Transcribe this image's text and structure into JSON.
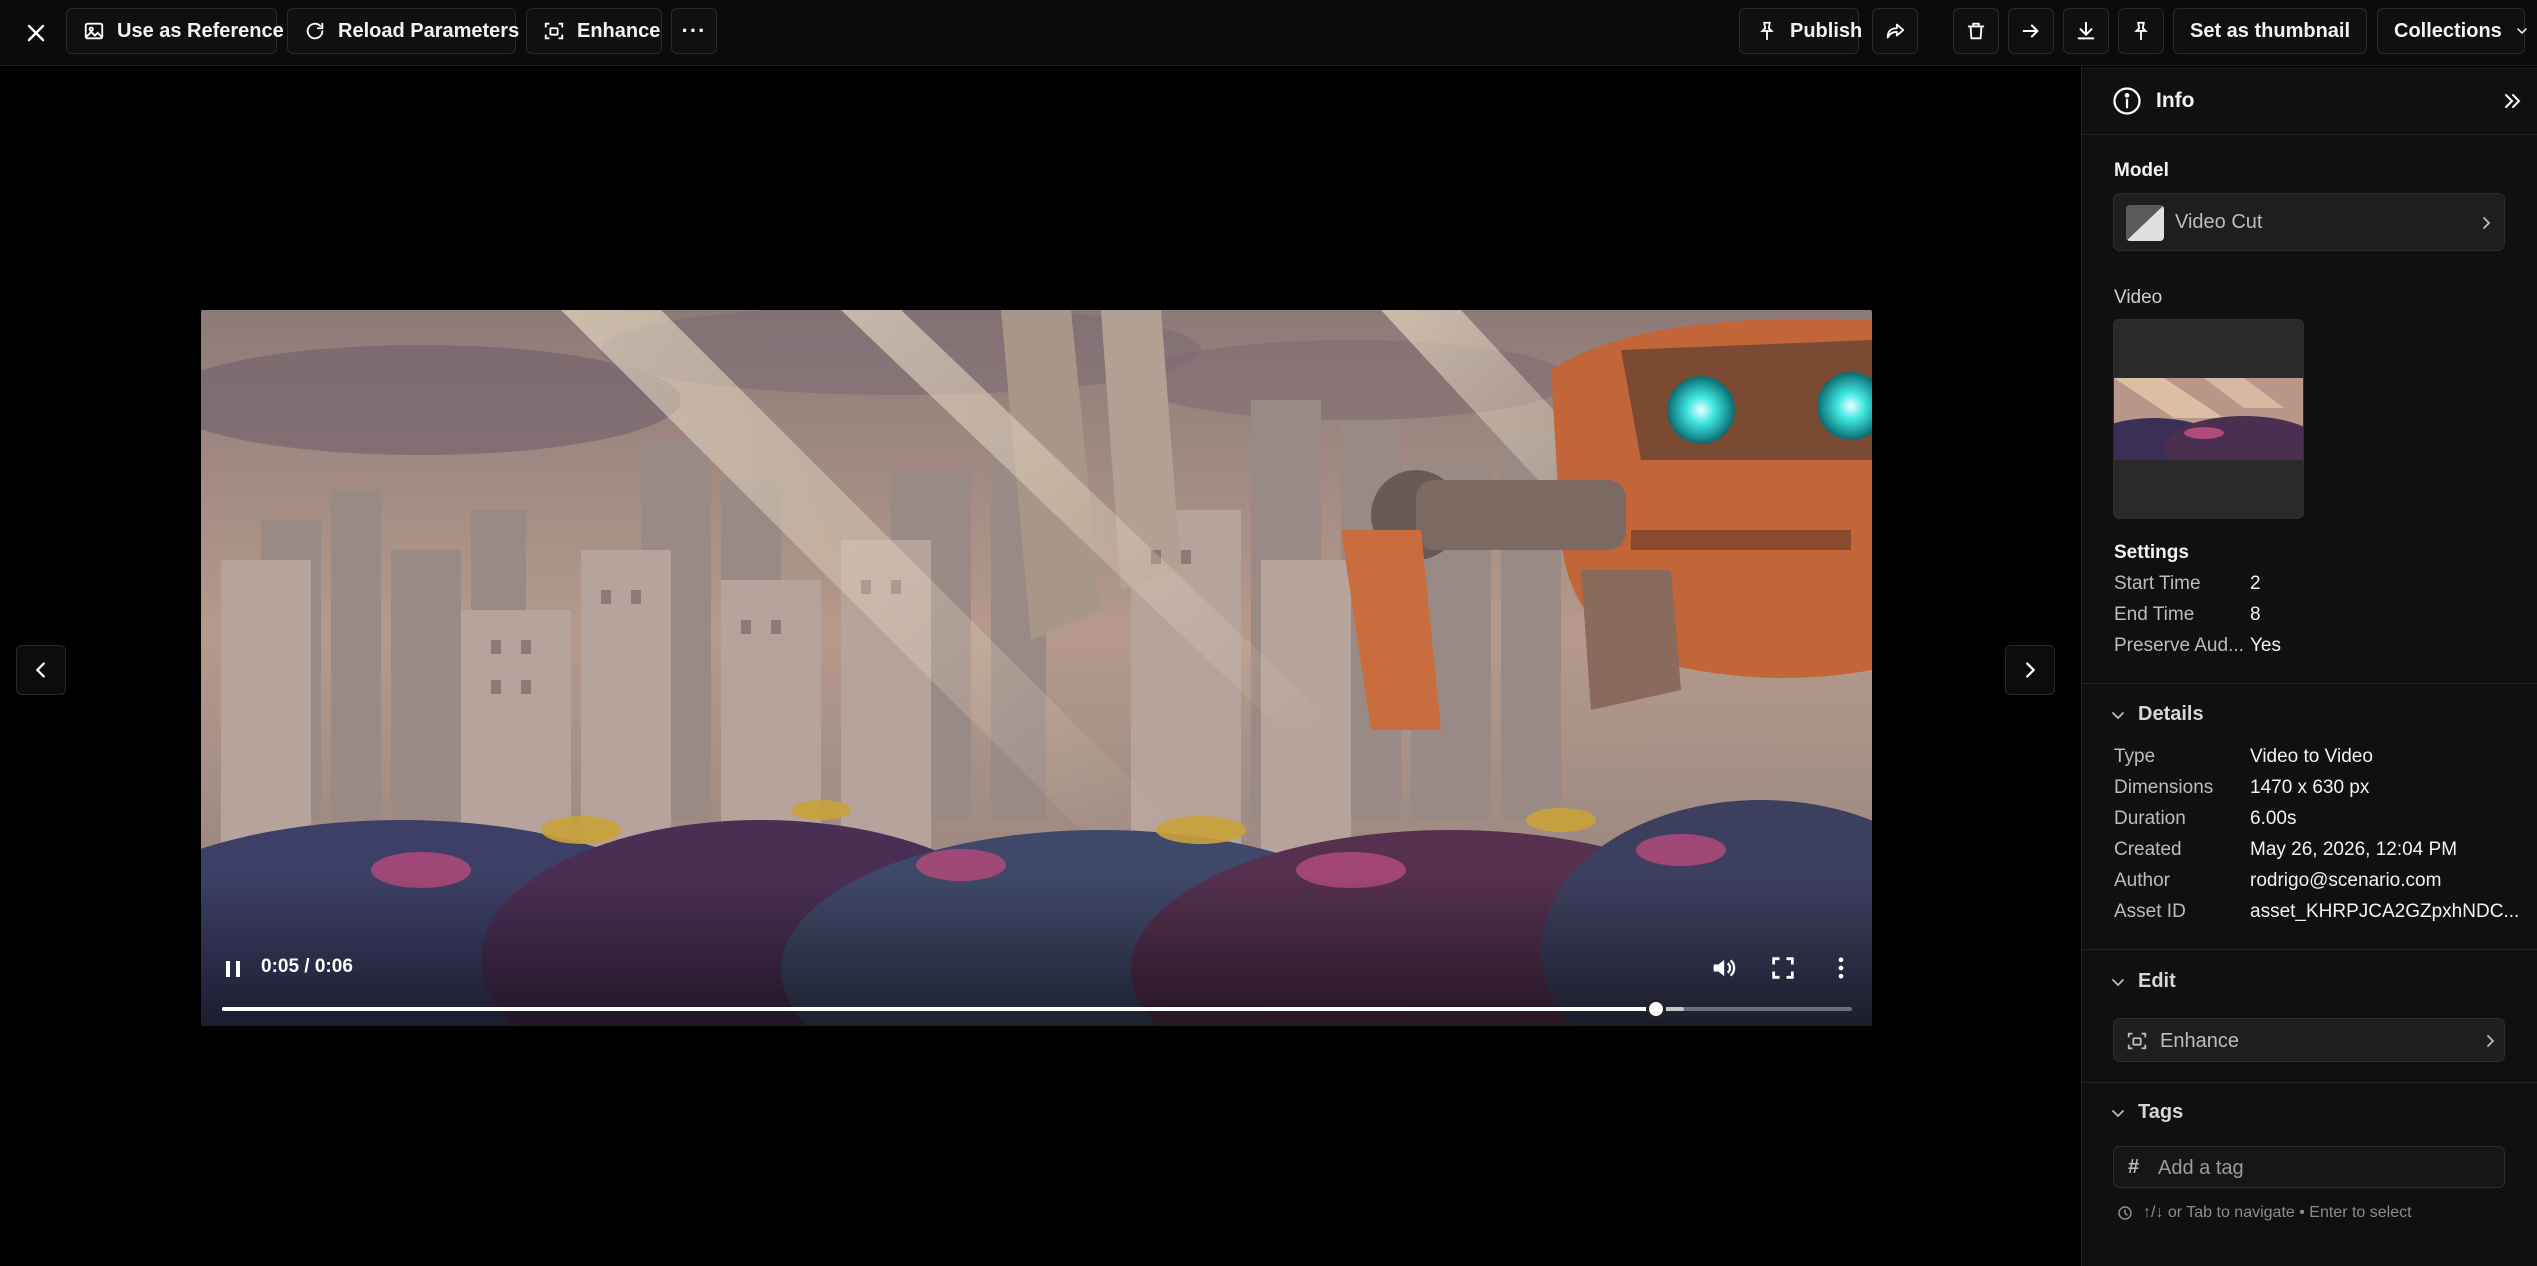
{
  "toolbar": {
    "use_as_reference": "Use as Reference",
    "reload_parameters": "Reload Parameters",
    "enhance": "Enhance",
    "more": "···",
    "publish": "Publish",
    "set_as_thumbnail": "Set as thumbnail",
    "collections": "Collections"
  },
  "player": {
    "time": "0:05 / 0:06",
    "progress_fraction": 0.88,
    "buffered_fraction": 0.897
  },
  "panel": {
    "title": "Info",
    "model_label": "Model",
    "model_name": "Video Cut",
    "video_label": "Video",
    "settings_label": "Settings",
    "settings": [
      {
        "key": "Start Time",
        "value": "2"
      },
      {
        "key": "End Time",
        "value": "8"
      },
      {
        "key": "Preserve Aud...",
        "value": "Yes"
      }
    ],
    "details_label": "Details",
    "details": [
      {
        "key": "Type",
        "value": "Video to Video"
      },
      {
        "key": "Dimensions",
        "value": "1470 x 630 px"
      },
      {
        "key": "Duration",
        "value": "6.00s"
      },
      {
        "key": "Created",
        "value": "May 26, 2026, 12:04 PM"
      },
      {
        "key": "Author",
        "value": "rodrigo@scenario.com"
      },
      {
        "key": "Asset ID",
        "value": "asset_KHRPJCA2GZpxhNDC..."
      }
    ],
    "edit_label": "Edit",
    "edit_action": "Enhance",
    "tags_label": "Tags",
    "tag_placeholder": "Add a tag",
    "tag_hint": "↑/↓ or Tab to navigate • Enter to select"
  },
  "colors": {
    "background": "#000000",
    "panel": "#101010",
    "border": "#2a2a2a",
    "robot_eye": "#3ee6e0"
  }
}
